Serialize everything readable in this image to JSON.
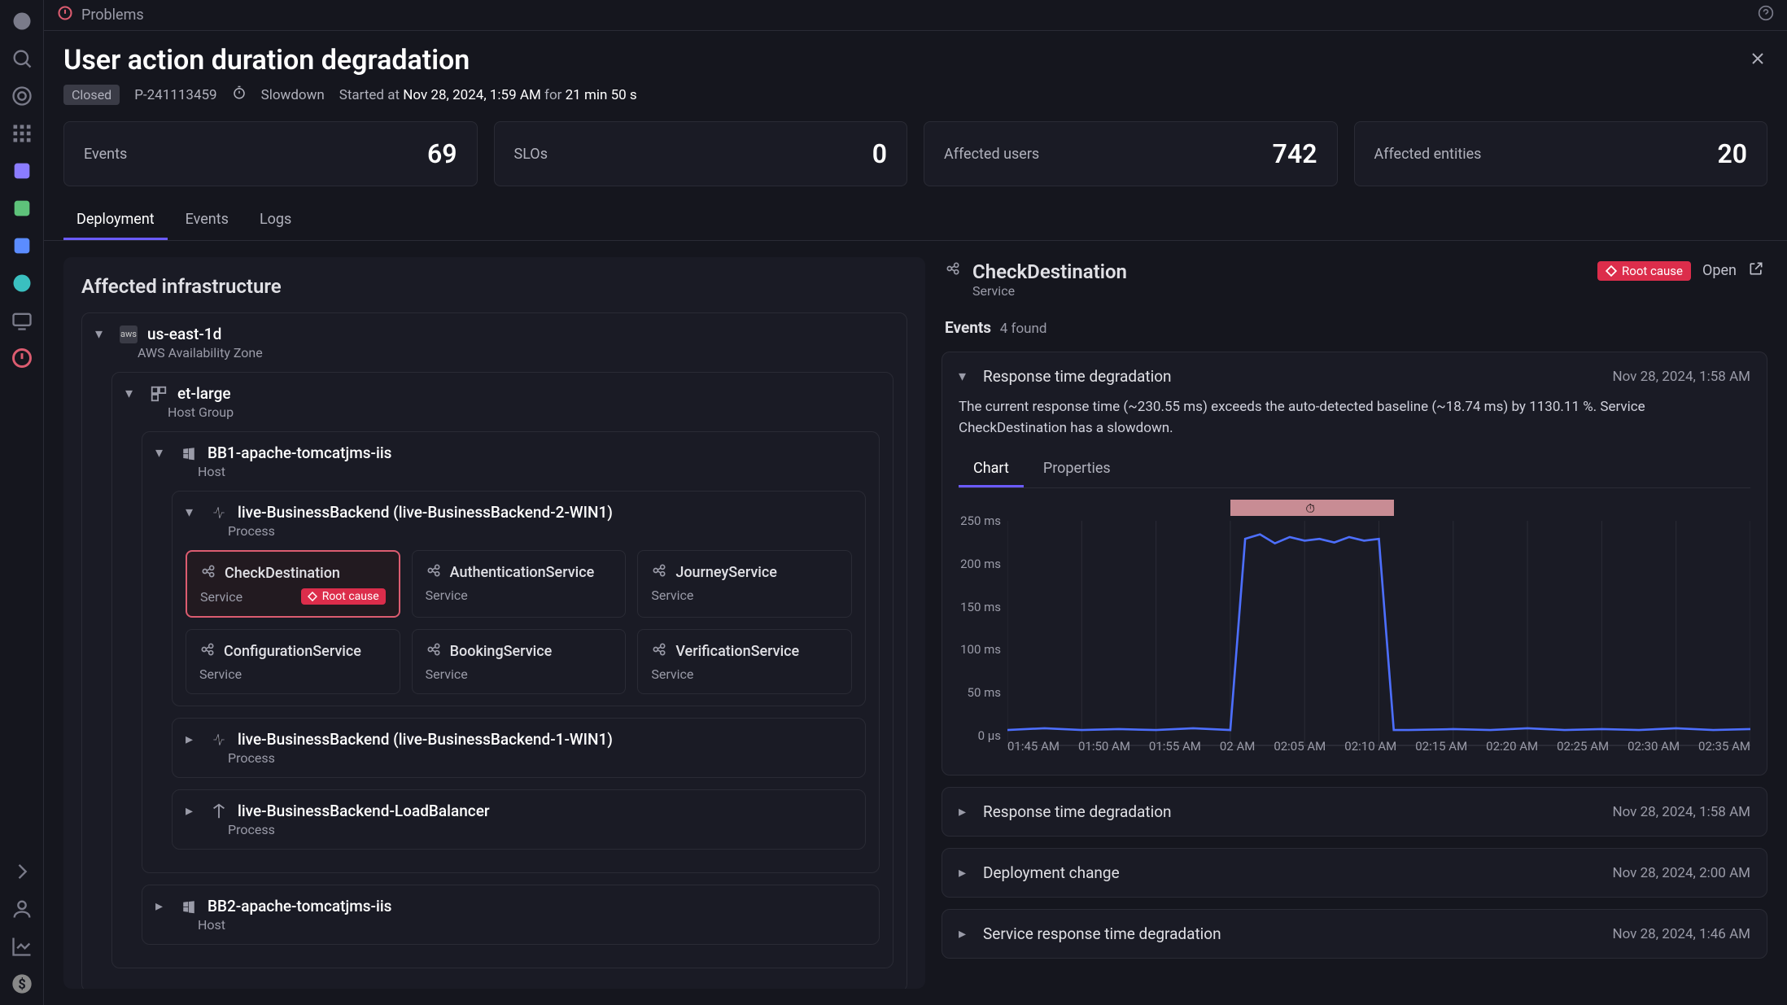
{
  "topbar": {
    "title": "Problems"
  },
  "header": {
    "title": "User action duration degradation",
    "status": "Closed",
    "problem_id": "P-241113459",
    "slowdown_label": "Slowdown",
    "started_prefix": "Started at",
    "started_time": "Nov 28, 2024, 1:59 AM",
    "started_for": "for",
    "duration": "21 min 50 s"
  },
  "metrics": [
    {
      "label": "Events",
      "value": "69"
    },
    {
      "label": "SLOs",
      "value": "0"
    },
    {
      "label": "Affected users",
      "value": "742"
    },
    {
      "label": "Affected entities",
      "value": "20"
    }
  ],
  "tabs": {
    "deployment": "Deployment",
    "events": "Events",
    "logs": "Logs"
  },
  "left": {
    "heading": "Affected infrastructure",
    "az": {
      "name": "us-east-1d",
      "type": "AWS Availability Zone"
    },
    "hostgroup": {
      "name": "et-large",
      "type": "Host Group"
    },
    "host1": {
      "name": "BB1-apache-tomcatjms-iis",
      "type": "Host"
    },
    "proc1": {
      "name": "live-BusinessBackend (live-BusinessBackend-2-WIN1)",
      "type": "Process"
    },
    "services": [
      {
        "name": "CheckDestination",
        "type": "Service",
        "root_cause": true
      },
      {
        "name": "AuthenticationService",
        "type": "Service"
      },
      {
        "name": "JourneyService",
        "type": "Service"
      },
      {
        "name": "ConfigurationService",
        "type": "Service"
      },
      {
        "name": "BookingService",
        "type": "Service"
      },
      {
        "name": "VerificationService",
        "type": "Service"
      }
    ],
    "proc2": {
      "name": "live-BusinessBackend (live-BusinessBackend-1-WIN1)",
      "type": "Process"
    },
    "proc3": {
      "name": "live-BusinessBackend-LoadBalancer",
      "type": "Process"
    },
    "host2": {
      "name": "BB2-apache-tomcatjms-iis",
      "type": "Host"
    },
    "root_cause_label": "Root cause"
  },
  "right": {
    "service_name": "CheckDestination",
    "service_type": "Service",
    "root_cause_label": "Root cause",
    "open_label": "Open",
    "events_label": "Events",
    "events_count": "4 found",
    "inner_tabs": {
      "chart": "Chart",
      "properties": "Properties"
    },
    "events": [
      {
        "title": "Response time degradation",
        "time": "Nov 28, 2024, 1:58 AM",
        "expanded": true,
        "description": "The current response time (~230.55 ms) exceeds the auto-detected baseline (~18.74 ms) by 1130.11 %. Service CheckDestination has a slowdown."
      },
      {
        "title": "Response time degradation",
        "time": "Nov 28, 2024, 1:58 AM"
      },
      {
        "title": "Deployment change",
        "time": "Nov 28, 2024, 2:00 AM"
      },
      {
        "title": "Service response time degradation",
        "time": "Nov 28, 2024, 1:46 AM"
      }
    ]
  },
  "chart_data": {
    "type": "line",
    "title": "",
    "xlabel": "",
    "ylabel": "",
    "ylim": [
      0,
      250
    ],
    "y_ticks": [
      "250 ms",
      "200 ms",
      "150 ms",
      "100 ms",
      "50 ms",
      "0 µs"
    ],
    "x_ticks": [
      "01:45 AM",
      "01:50 AM",
      "01:55 AM",
      "02 AM",
      "02:05 AM",
      "02:10 AM",
      "02:15 AM",
      "02:20 AM",
      "02:25 AM",
      "02:30 AM",
      "02:35 AM"
    ],
    "highlight_range_x": [
      3,
      5.2
    ],
    "series": [
      {
        "name": "Response time",
        "color": "#4d6fff",
        "x": [
          0,
          0.5,
          1,
          1.5,
          2,
          2.5,
          3,
          3.2,
          3.4,
          3.6,
          3.8,
          4,
          4.2,
          4.4,
          4.6,
          4.8,
          5,
          5.2,
          5.4,
          6,
          6.5,
          7,
          7.5,
          8,
          8.5,
          9,
          9.5,
          10
        ],
        "values": [
          18,
          20,
          18,
          19,
          18,
          20,
          18,
          230,
          235,
          225,
          232,
          228,
          230,
          226,
          232,
          228,
          230,
          18,
          18,
          19,
          18,
          20,
          18,
          19,
          18,
          20,
          18,
          19
        ]
      }
    ]
  }
}
